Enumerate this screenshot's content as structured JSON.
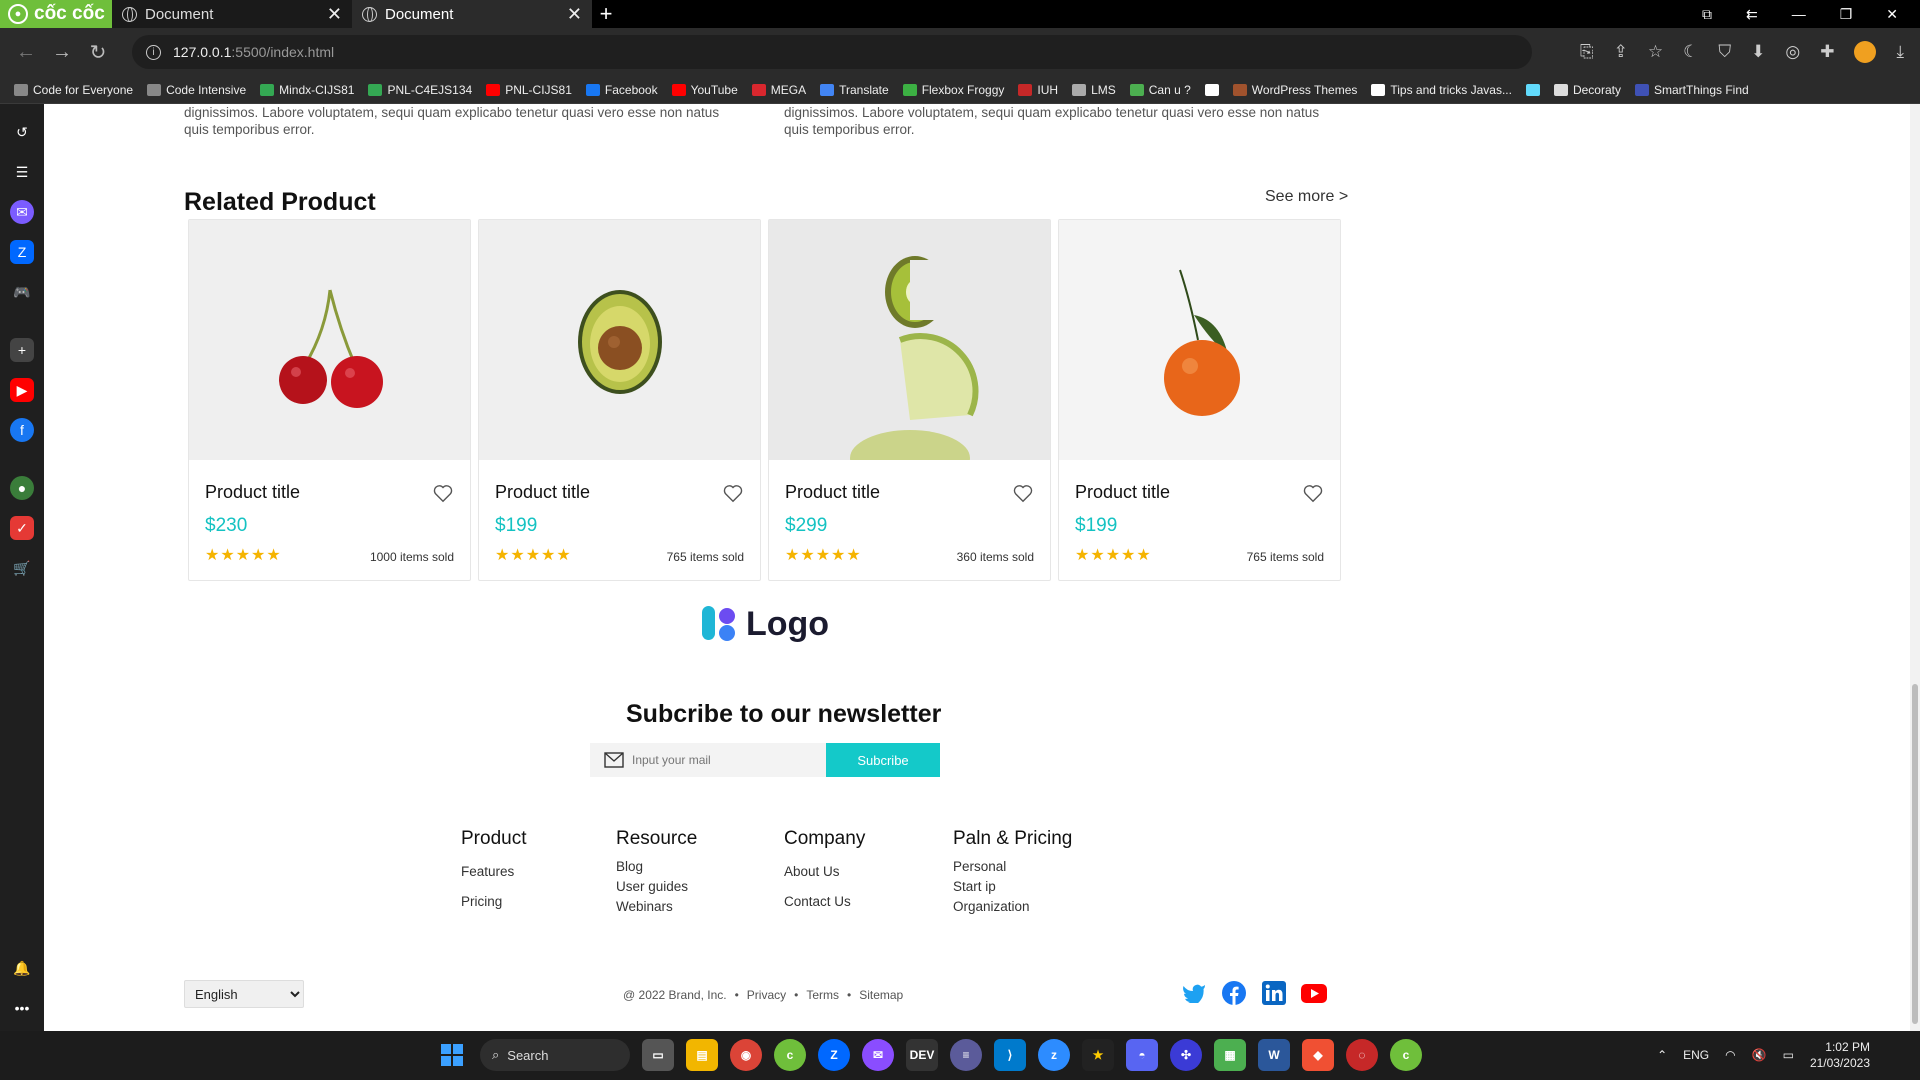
{
  "browser": {
    "brand": "cốc cốc",
    "tabs": [
      {
        "title": "Document",
        "close": "✕"
      },
      {
        "title": "Document",
        "close": "✕"
      }
    ],
    "new_tab": "+",
    "url_host": "127.0.0.1",
    "url_path": ":5500/index.html"
  },
  "bookmarks": [
    {
      "label": "Code for Everyone",
      "color": "#888888"
    },
    {
      "label": "Code Intensive",
      "color": "#888888"
    },
    {
      "label": "Mindx-CIJS81",
      "color": "#34a853"
    },
    {
      "label": "PNL-C4EJS134",
      "color": "#34a853"
    },
    {
      "label": "PNL-CIJS81",
      "color": "#ff0000"
    },
    {
      "label": "Facebook",
      "color": "#1877f2"
    },
    {
      "label": "YouTube",
      "color": "#ff0000"
    },
    {
      "label": "MEGA",
      "color": "#d9272e"
    },
    {
      "label": "Translate",
      "color": "#4285f4"
    },
    {
      "label": "Flexbox Froggy",
      "color": "#3cb043"
    },
    {
      "label": "IUH",
      "color": "#c62828"
    },
    {
      "label": "LMS",
      "color": "#aaaaaa"
    },
    {
      "label": "Can u ?",
      "color": "#4caf50"
    },
    {
      "label": "",
      "color": "#ffffff"
    },
    {
      "label": "WordPress Themes",
      "color": "#a0522d"
    },
    {
      "label": "Tips and tricks Javas...",
      "color": "#ffffff"
    },
    {
      "label": "",
      "color": "#61dafb"
    },
    {
      "label": "Decoraty",
      "color": "#dddddd"
    },
    {
      "label": "SmartThings Find",
      "color": "#3f51b5"
    }
  ],
  "page": {
    "desc_left": "dignissimos. Labore voluptatem, sequi quam explicabo tenetur quasi vero esse non natus quis temporibus error.",
    "desc_right": "dignissimos. Labore voluptatem, sequi quam explicabo tenetur quasi vero esse non natus quis temporibus error.",
    "related_title": "Related Product",
    "see_more": "See more >",
    "products": [
      {
        "title": "Product title",
        "price": "$230",
        "stars": "★★★★★",
        "sold": "1000 items sold",
        "image": "cherry-image"
      },
      {
        "title": "Product title",
        "price": "$199",
        "stars": "★★★★★",
        "sold": "765 items sold",
        "image": "avocado-image"
      },
      {
        "title": "Product title",
        "price": "$299",
        "stars": "★★★★★",
        "sold": "360 items sold",
        "image": "kiwi-lime-image"
      },
      {
        "title": "Product title",
        "price": "$199",
        "stars": "★★★★★",
        "sold": "765 items sold",
        "image": "tangerine-image"
      }
    ],
    "logo_text": "Logo",
    "newsletter_title": "Subcribe to our newsletter",
    "newsletter_placeholder": "Input your mail",
    "newsletter_button": "Subcribe",
    "footer_columns": [
      {
        "heading": "Product",
        "links": [
          "Features",
          "Pricing"
        ]
      },
      {
        "heading": "Resource",
        "links": [
          "Blog",
          "User guides",
          "Webinars"
        ]
      },
      {
        "heading": "Company",
        "links": [
          "About Us",
          "Contact Us"
        ]
      },
      {
        "heading": "Paln & Pricing",
        "links": [
          "Personal",
          "Start ip",
          "Organization"
        ]
      }
    ],
    "language": "English",
    "copyright": "@ 2022 Brand, Inc.",
    "legal_links": [
      "Privacy",
      "Terms",
      "Sitemap"
    ],
    "social_colors": {
      "twitter": "#1da1f2",
      "facebook": "#1877f2",
      "linkedin": "#0a66c2",
      "youtube": "#ff0000"
    },
    "accent": "#14c9c9"
  },
  "taskbar": {
    "search_label": "Search",
    "lang": "ENG",
    "time": "1:02 PM",
    "date": "21/03/2023"
  }
}
